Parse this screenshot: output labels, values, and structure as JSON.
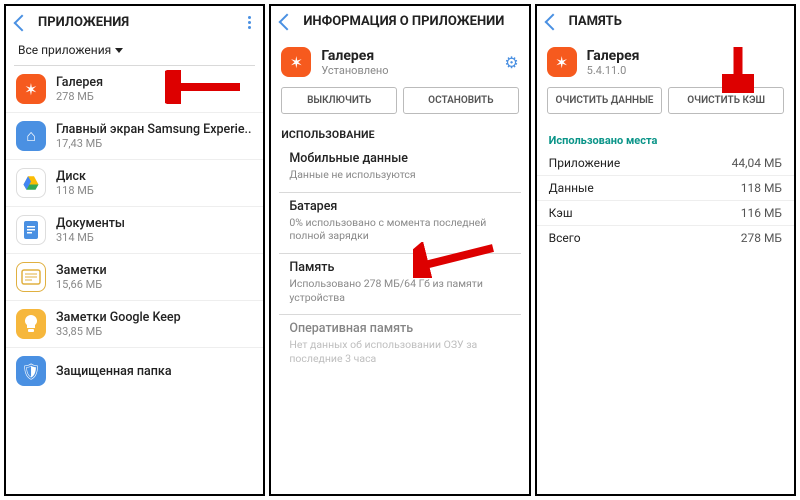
{
  "pane1": {
    "title": "ПРИЛОЖЕНИЯ",
    "filter": "Все приложения",
    "apps": [
      {
        "name": "Галерея",
        "size": "278 МБ"
      },
      {
        "name": "Главный экран Samsung Experie..",
        "size": "17,43 МБ"
      },
      {
        "name": "Диск",
        "size": "118 МБ"
      },
      {
        "name": "Документы",
        "size": "314 МБ"
      },
      {
        "name": "Заметки",
        "size": "15,66 МБ"
      },
      {
        "name": "Заметки Google Keep",
        "size": "33,85 МБ"
      },
      {
        "name": "Защищенная папка",
        "size": ""
      }
    ]
  },
  "pane2": {
    "title": "ИНФОРМАЦИЯ О ПРИЛОЖЕНИИ",
    "app_name": "Галерея",
    "app_status": "Установлено",
    "btn_disable": "ВЫКЛЮЧИТЬ",
    "btn_stop": "ОСТАНОВИТЬ",
    "section_usage": "ИСПОЛЬЗОВАНИЕ",
    "mobile_title": "Мобильные данные",
    "mobile_sub": "Данные не используются",
    "battery_title": "Батарея",
    "battery_sub": "0% использовано с момента последней полной зарядки",
    "storage_title": "Память",
    "storage_sub": "Использовано 278 МБ/64 Гб из памяти устройства",
    "ram_title": "Оперативная память",
    "ram_sub": "Нет данных об использовании ОЗУ за последние 3 часа"
  },
  "pane3": {
    "title": "ПАМЯТЬ",
    "app_name": "Галерея",
    "app_version": "5.4.11.0",
    "btn_clear_data": "ОЧИСТИТЬ ДАННЫЕ",
    "btn_clear_cache": "ОЧИСТИТЬ КЭШ",
    "section_used": "Использовано места",
    "rows": [
      {
        "k": "Приложение",
        "v": "44,04 МБ"
      },
      {
        "k": "Данные",
        "v": "118 МБ"
      },
      {
        "k": "Кэш",
        "v": "116 МБ"
      },
      {
        "k": "Всего",
        "v": "278 МБ"
      }
    ]
  }
}
